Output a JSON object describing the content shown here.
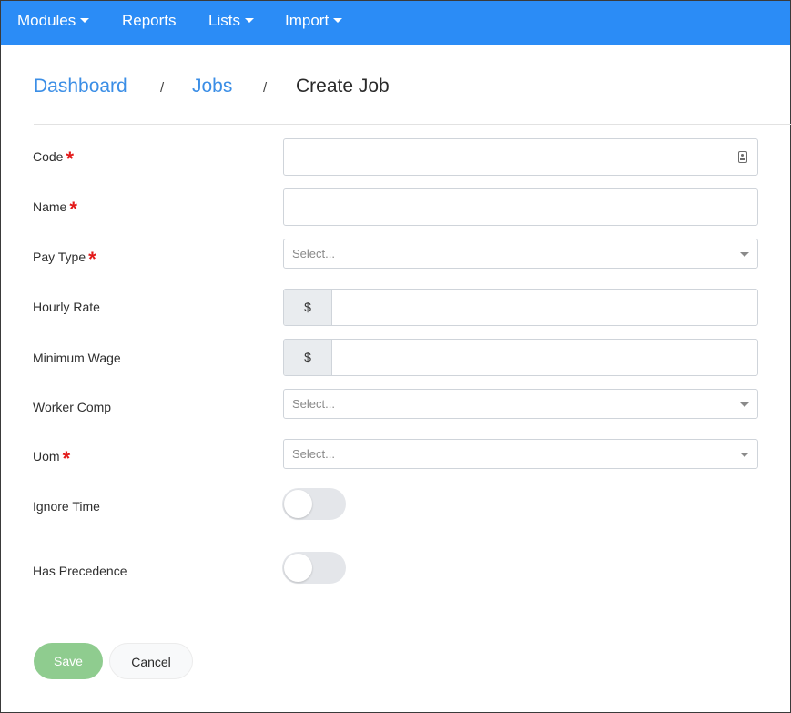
{
  "nav": {
    "items": [
      {
        "label": "Modules",
        "dropdown": true
      },
      {
        "label": "Reports",
        "dropdown": false
      },
      {
        "label": "Lists",
        "dropdown": true
      },
      {
        "label": "Import",
        "dropdown": true
      }
    ],
    "color": "#2b8cf6"
  },
  "breadcrumb": {
    "items": [
      "Dashboard",
      "Jobs",
      "Create Job"
    ],
    "separator": "/"
  },
  "form": {
    "code": {
      "label": "Code",
      "required": true,
      "value": "",
      "icon": "id-card-icon"
    },
    "name": {
      "label": "Name",
      "required": true,
      "value": ""
    },
    "pay_type": {
      "label": "Pay Type",
      "required": true,
      "placeholder": "Select..."
    },
    "hourly_rate": {
      "label": "Hourly Rate",
      "prefix": "$",
      "value": ""
    },
    "minimum_wage": {
      "label": "Minimum Wage",
      "prefix": "$",
      "value": ""
    },
    "worker_comp": {
      "label": "Worker Comp",
      "placeholder": "Select..."
    },
    "uom": {
      "label": "Uom",
      "required": true,
      "placeholder": "Select..."
    },
    "ignore_time": {
      "label": "Ignore Time",
      "on": false
    },
    "has_precedence": {
      "label": "Has Precedence",
      "on": false
    }
  },
  "required_marker": "*",
  "buttons": {
    "save": "Save",
    "cancel": "Cancel"
  },
  "colors": {
    "save": "#8fcc8f",
    "link": "#3b8ee6",
    "required": "#e31b1b"
  }
}
